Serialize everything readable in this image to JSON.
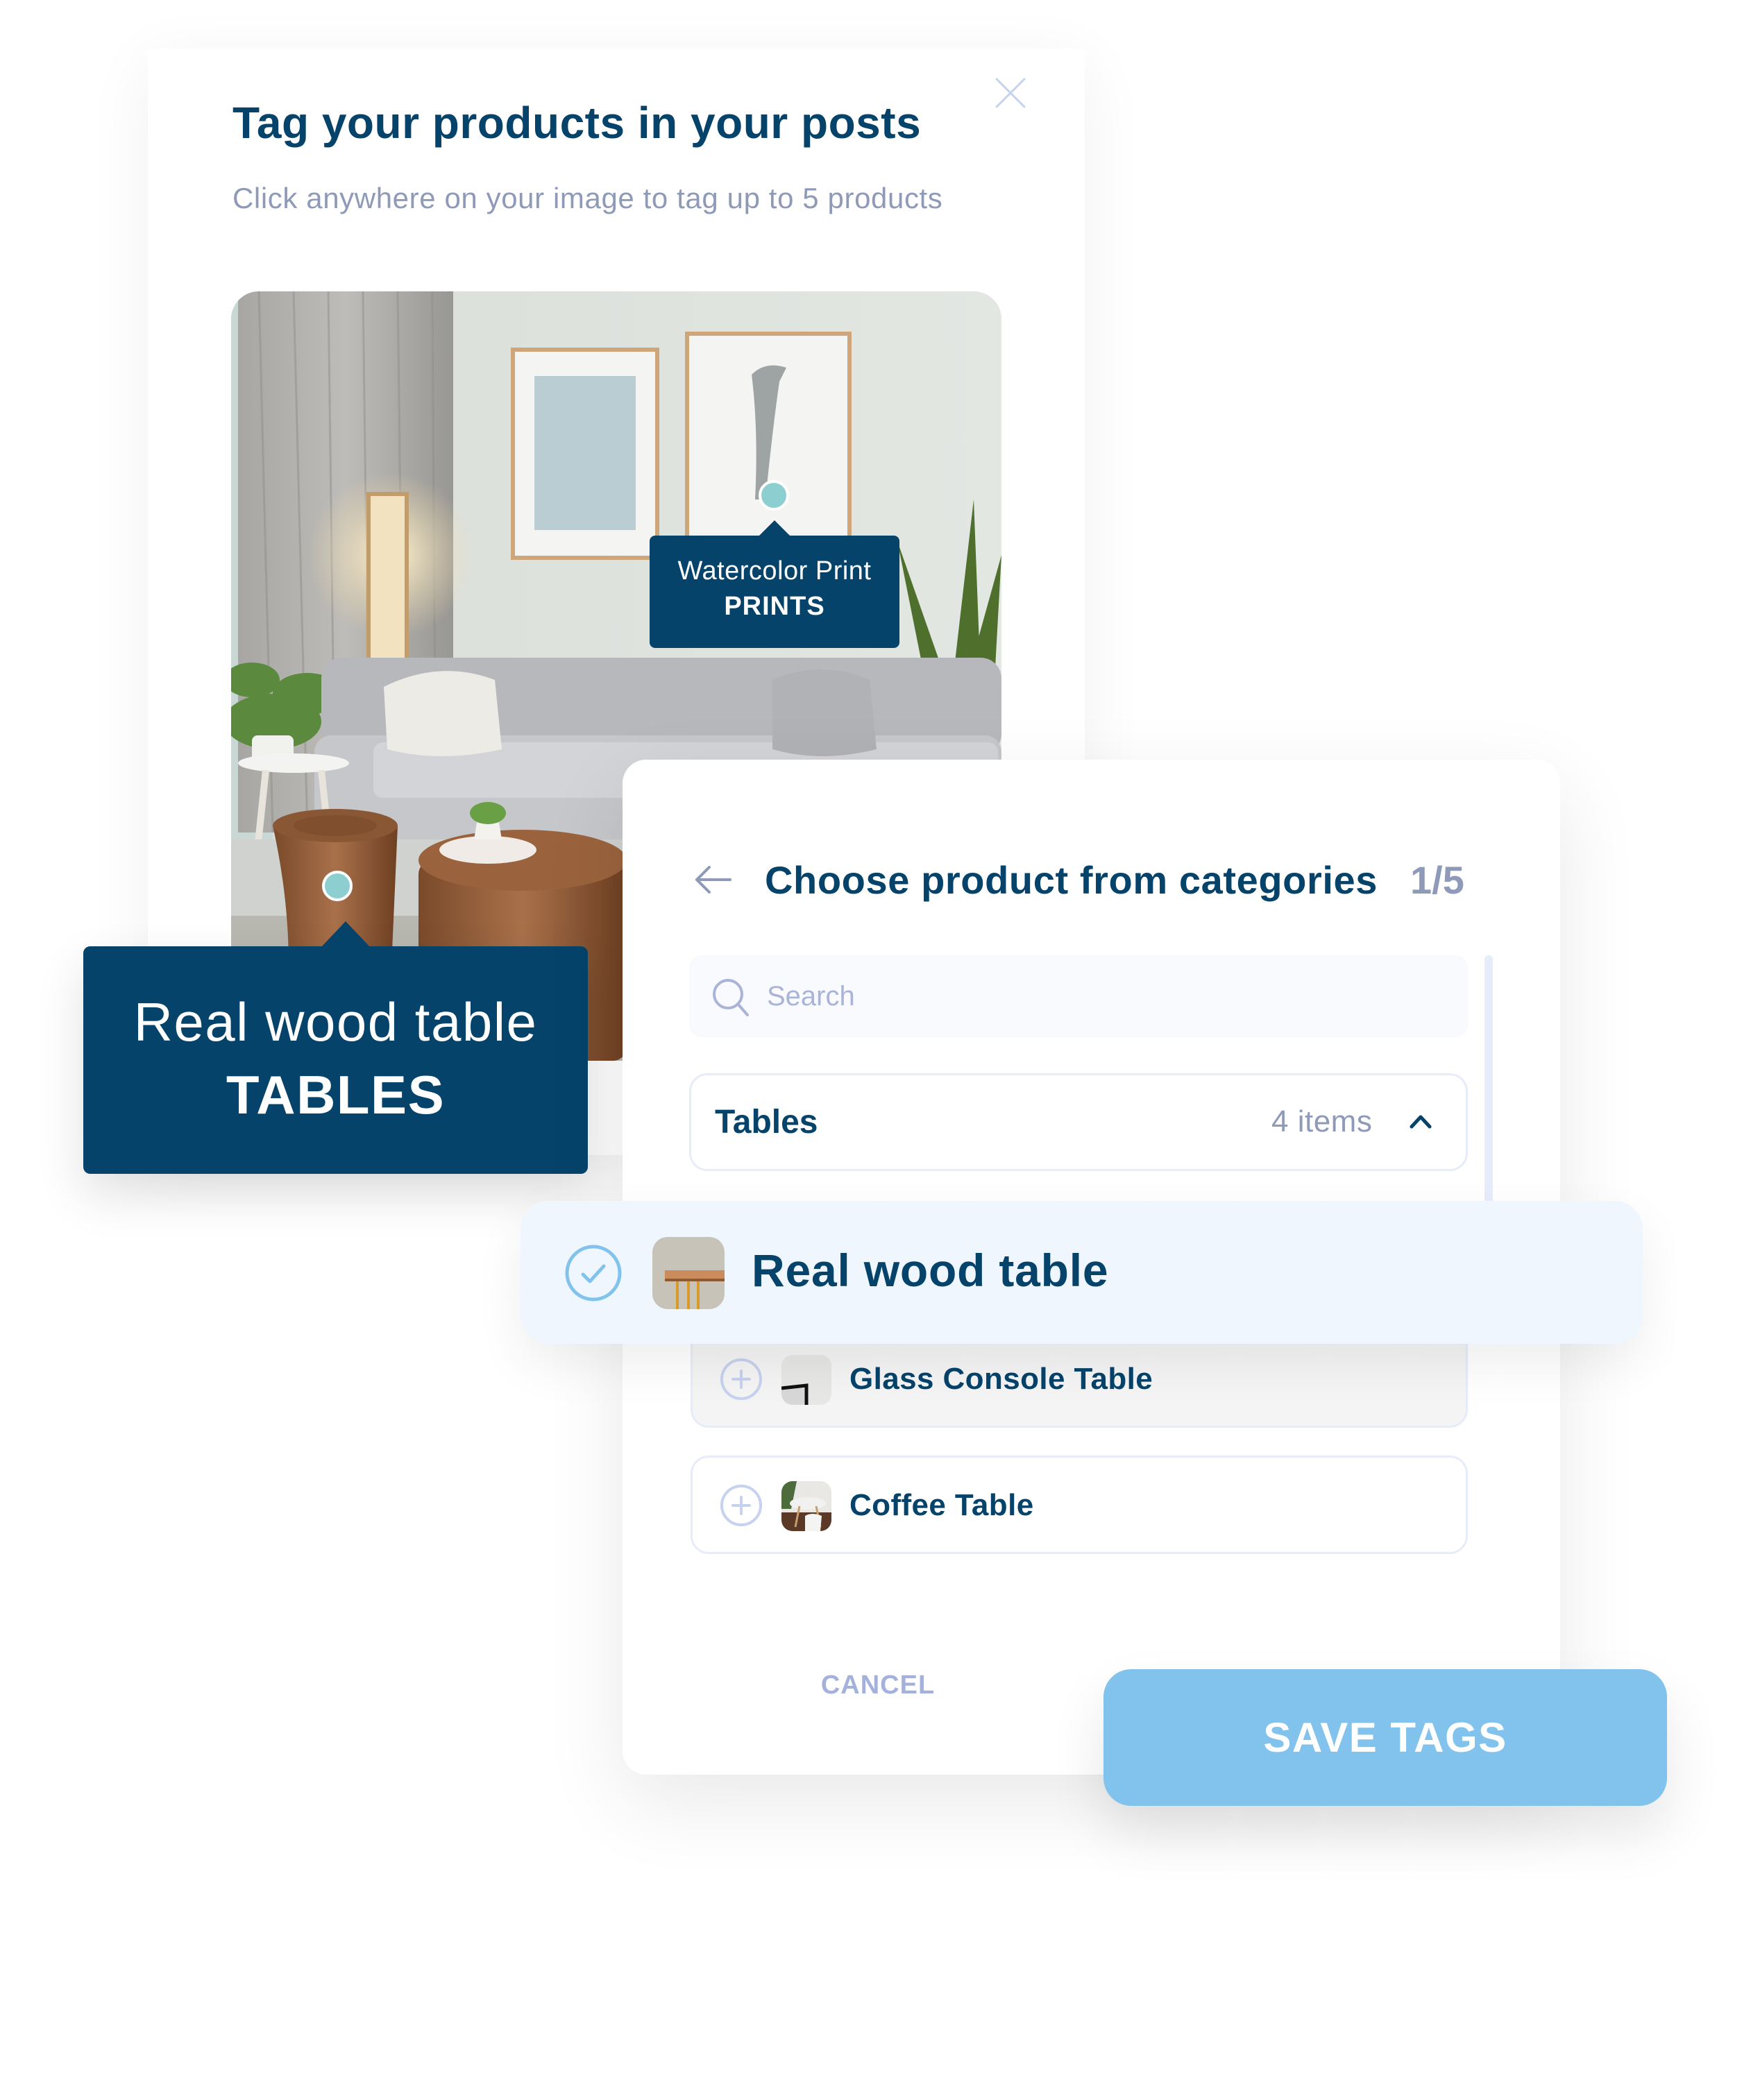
{
  "modal": {
    "title": "Tag your products in your posts",
    "subtitle": "Click anywhere on your image to tag up to 5 products",
    "close_icon": "close-icon"
  },
  "photo": {
    "description": "living room with sofa, framed prints, floor lamp, plants and wooden side tables",
    "tags": [
      {
        "name": "Watercolor Print",
        "category": "PRINTS"
      },
      {
        "name": "Real wood table",
        "category": "TABLES"
      }
    ]
  },
  "panel": {
    "back_icon": "arrow-left-icon",
    "title": "Choose product from categories",
    "counter": "1/5",
    "search": {
      "placeholder": "Search",
      "value": "",
      "icon": "search-icon"
    },
    "category": {
      "name": "Tables",
      "count": "4 items",
      "expanded": true,
      "icon": "chevron-up-icon"
    },
    "selected_item": {
      "label": "Real wood table",
      "selected": true,
      "icon": "check-circle-icon"
    },
    "items": [
      {
        "label": "Glass Console Table",
        "selected": false,
        "icon": "plus-circle-icon"
      },
      {
        "label": "Coffee Table",
        "selected": false,
        "icon": "plus-circle-icon"
      }
    ],
    "cancel_label": "CANCEL",
    "save_label": "SAVE TAGS"
  },
  "colors": {
    "primary_navy": "#05436b",
    "muted_text": "#8e9ab8",
    "accent_blue": "#82c3ee",
    "tag_dot": "#8dcfd1",
    "selected_bg": "#eff6fd",
    "border": "#e6ecf9"
  }
}
